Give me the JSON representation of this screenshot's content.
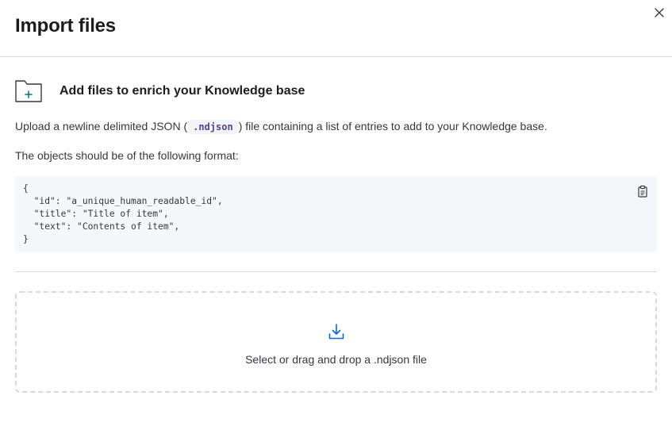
{
  "flyout": {
    "title": "Import files"
  },
  "callout": {
    "title": "Add files to enrich your Knowledge base",
    "icon": "folder-add-icon"
  },
  "description": {
    "before_code": "Upload a newline delimited JSON (",
    "code": ".ndjson",
    "after_code": ") file containing a list of entries to add to your Knowledge base."
  },
  "format_intro": "The objects should be of the following format:",
  "code_block": {
    "content": "{\n  \"id\": \"a_unique_human_readable_id\",\n  \"title\": \"Title of item\",\n  \"text\": \"Contents of item\",\n}",
    "copy_icon": "copy-clipboard-icon"
  },
  "dropzone": {
    "prompt": "Select or drag and drop a .ndjson file",
    "icon": "download-icon"
  },
  "colors": {
    "accent": "#0b64dd",
    "code_accent": "#5a3e91",
    "border": "#d3dae6",
    "code_bg": "#f5f7fa"
  }
}
